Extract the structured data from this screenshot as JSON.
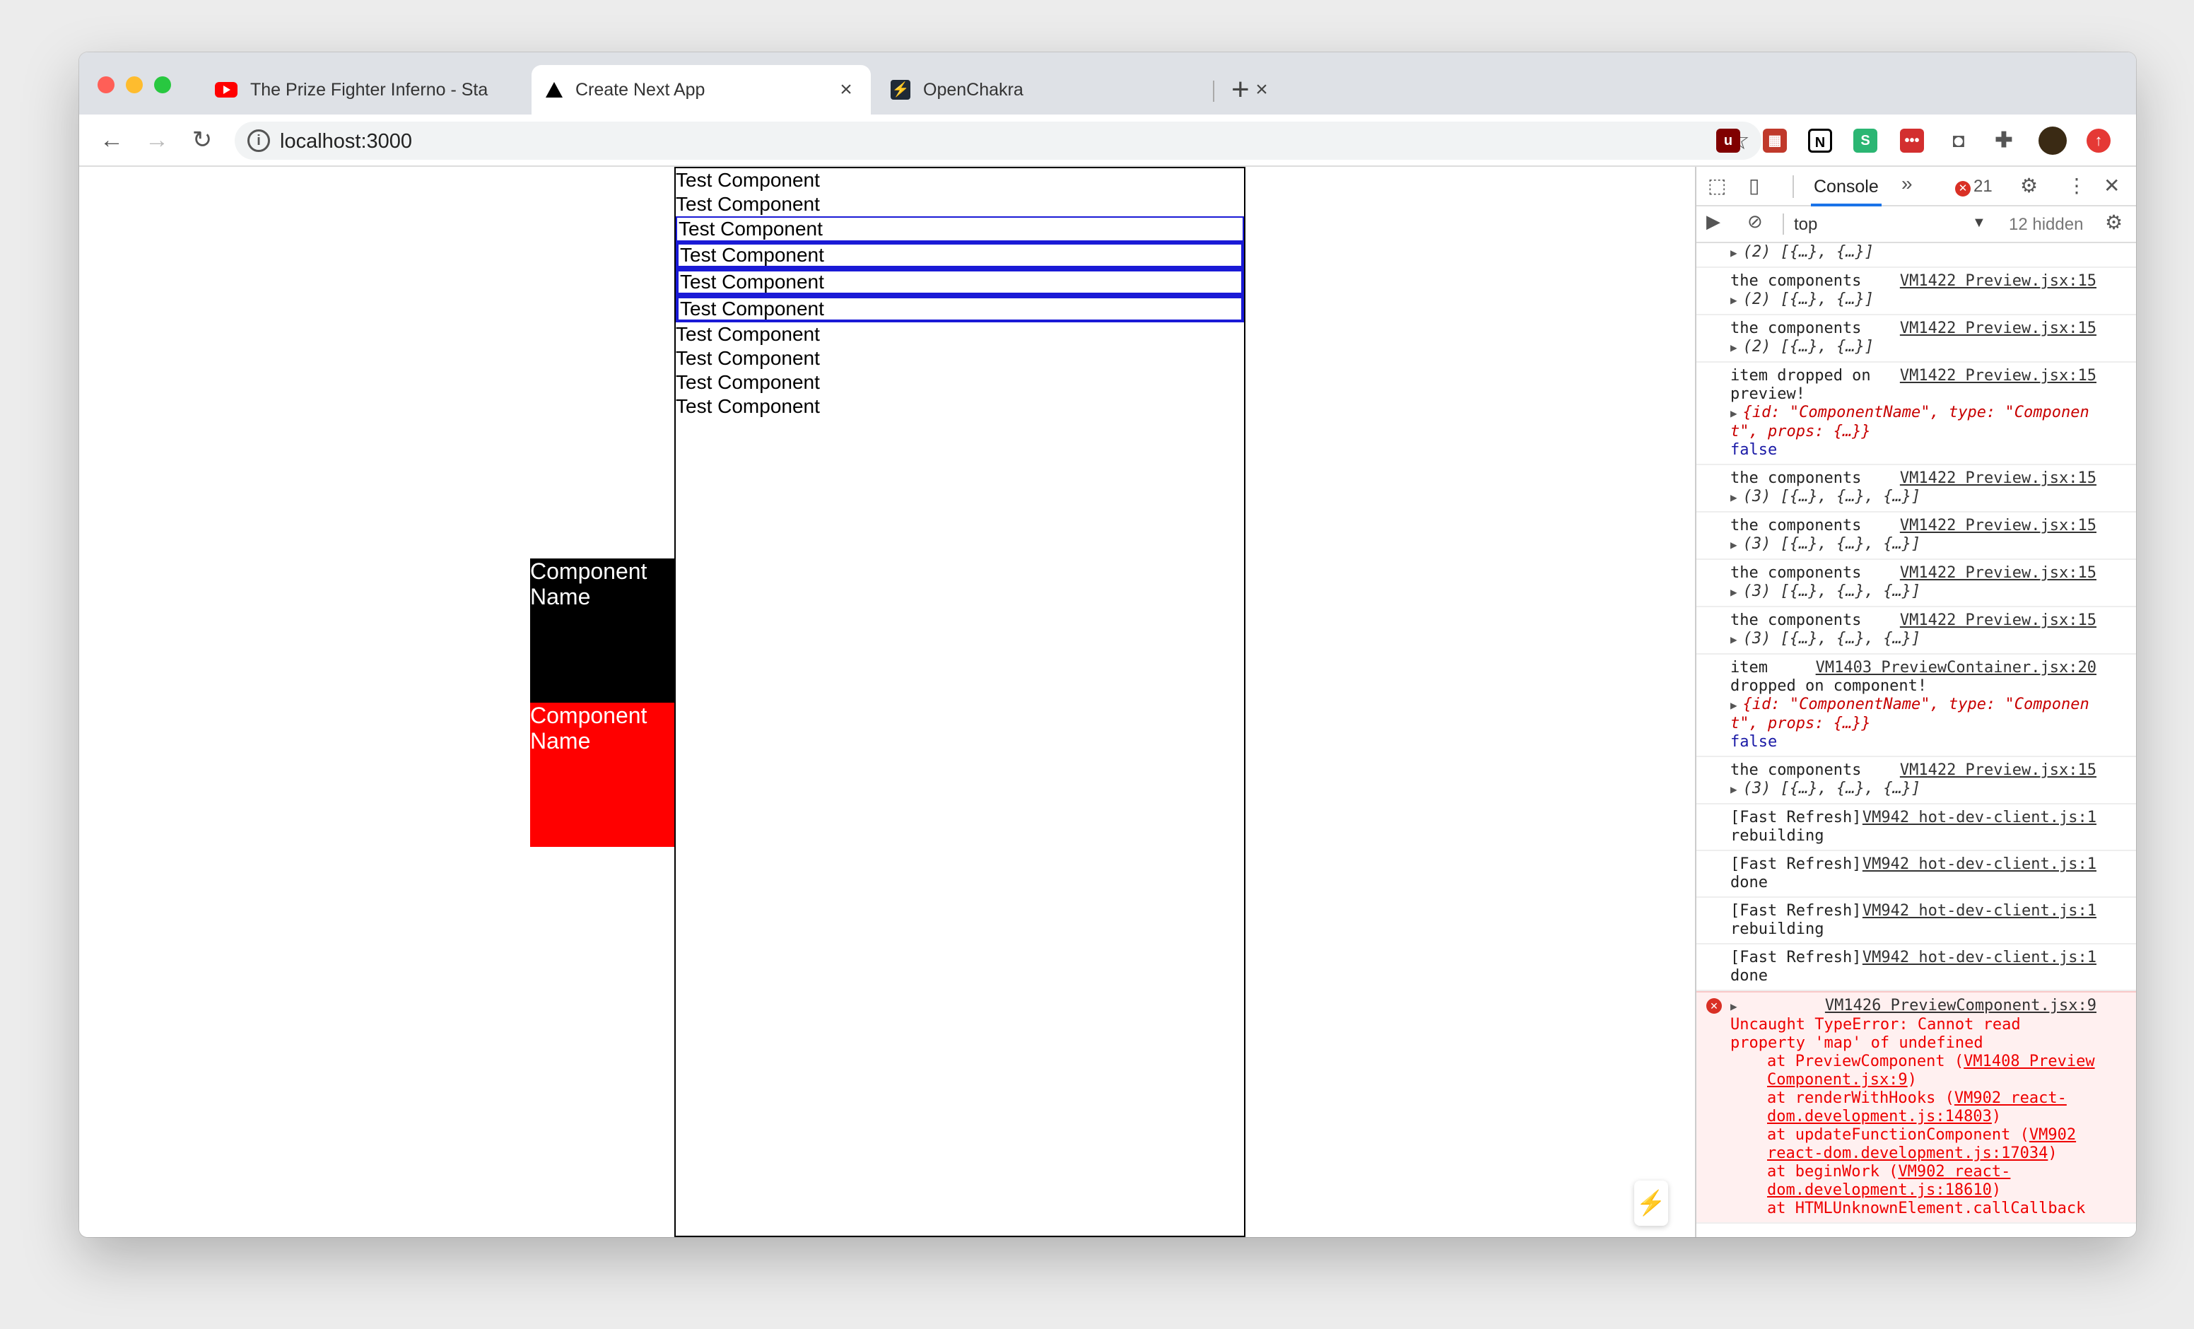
{
  "browser": {
    "tabs": [
      {
        "title": "The Prize Fighter Inferno - Sta",
        "icon": "youtube-icon",
        "active": false
      },
      {
        "title": "Create Next App",
        "icon": "nextjs-triangle-icon",
        "active": true
      },
      {
        "title": "OpenChakra",
        "icon": "openchakra-icon",
        "active": false
      }
    ],
    "new_tab": "+",
    "close_glyph": "×",
    "url": "localhost:3000"
  },
  "page": {
    "rows": [
      "Test Component",
      "Test Component",
      "Test Component",
      "Test Component",
      "Test Component",
      "Test Component",
      "Test Component",
      "Test Component",
      "Test Component",
      "Test Component"
    ],
    "box_black": "Component Name",
    "box_red": "Component Name"
  },
  "devtools": {
    "tab": "Console",
    "more": "»",
    "error_count": "21",
    "context": "top",
    "hidden": "12 hidden",
    "messages": [
      {
        "text": "",
        "src": "",
        "obj": "(2) [{…}, {…}]"
      },
      {
        "text": "the components",
        "src": "VM1422 Preview.jsx:15",
        "obj": "(2) [{…}, {…}]"
      },
      {
        "text": "the components",
        "src": "VM1422 Preview.jsx:15",
        "obj": "(2) [{…}, {…}]"
      },
      {
        "text": "item dropped on preview!",
        "src": "VM1422 Preview.jsx:15",
        "obj": "{id: \"ComponentName\", type: \"Componen t\", props: {…}}",
        "extra": "false"
      },
      {
        "text": "the components",
        "src": "VM1422 Preview.jsx:15",
        "obj": "(3) [{…}, {…}, {…}]"
      },
      {
        "text": "the components",
        "src": "VM1422 Preview.jsx:15",
        "obj": "(3) [{…}, {…}, {…}]"
      },
      {
        "text": "the components",
        "src": "VM1422 Preview.jsx:15",
        "obj": "(3) [{…}, {…}, {…}]"
      },
      {
        "text": "the components",
        "src": "VM1422 Preview.jsx:15",
        "obj": "(3) [{…}, {…}, {…}]"
      },
      {
        "text": "item dropped on component!",
        "src": "VM1403 PreviewContainer.jsx:20",
        "obj": "{id: \"ComponentName\", type: \"Componen t\", props: {…}}",
        "extra": "false"
      },
      {
        "text": "the components",
        "src": "VM1422 Preview.jsx:15",
        "obj": "(3) [{…}, {…}, {…}]"
      },
      {
        "text": "[Fast Refresh] rebuilding",
        "src": "VM942 hot-dev-client.js:1",
        "obj": ""
      },
      {
        "text": "[Fast Refresh] done",
        "src": "VM942 hot-dev-client.js:1",
        "obj": ""
      },
      {
        "text": "[Fast Refresh] rebuilding",
        "src": "VM942 hot-dev-client.js:1",
        "obj": ""
      },
      {
        "text": "[Fast Refresh] done",
        "src": "VM942 hot-dev-client.js:1",
        "obj": ""
      }
    ],
    "error": {
      "src": "VM1426 PreviewComponent.jsx:9",
      "text": "Uncaught TypeError: Cannot read property 'map' of undefined",
      "stack": [
        {
          "fn": "at PreviewComponent (",
          "ref": "VM1408 Preview Component.jsx:9",
          "end": ")"
        },
        {
          "fn": "at renderWithHooks (",
          "ref": "VM902 react-dom.development.js:14803",
          "end": ")"
        },
        {
          "fn": "at updateFunctionComponent (",
          "ref": "VM902 react-dom.development.js:17034",
          "end": ")"
        },
        {
          "fn": "at beginWork (",
          "ref": "VM902 react-dom.development.js:18610",
          "end": ")"
        },
        {
          "fn": "at HTMLUnknownElement.callCallback",
          "ref": "",
          "end": ""
        }
      ]
    }
  },
  "colors": {
    "selection_border": "#1a1ad6",
    "red_box": "#ff0000",
    "error_text": "#e00000"
  }
}
